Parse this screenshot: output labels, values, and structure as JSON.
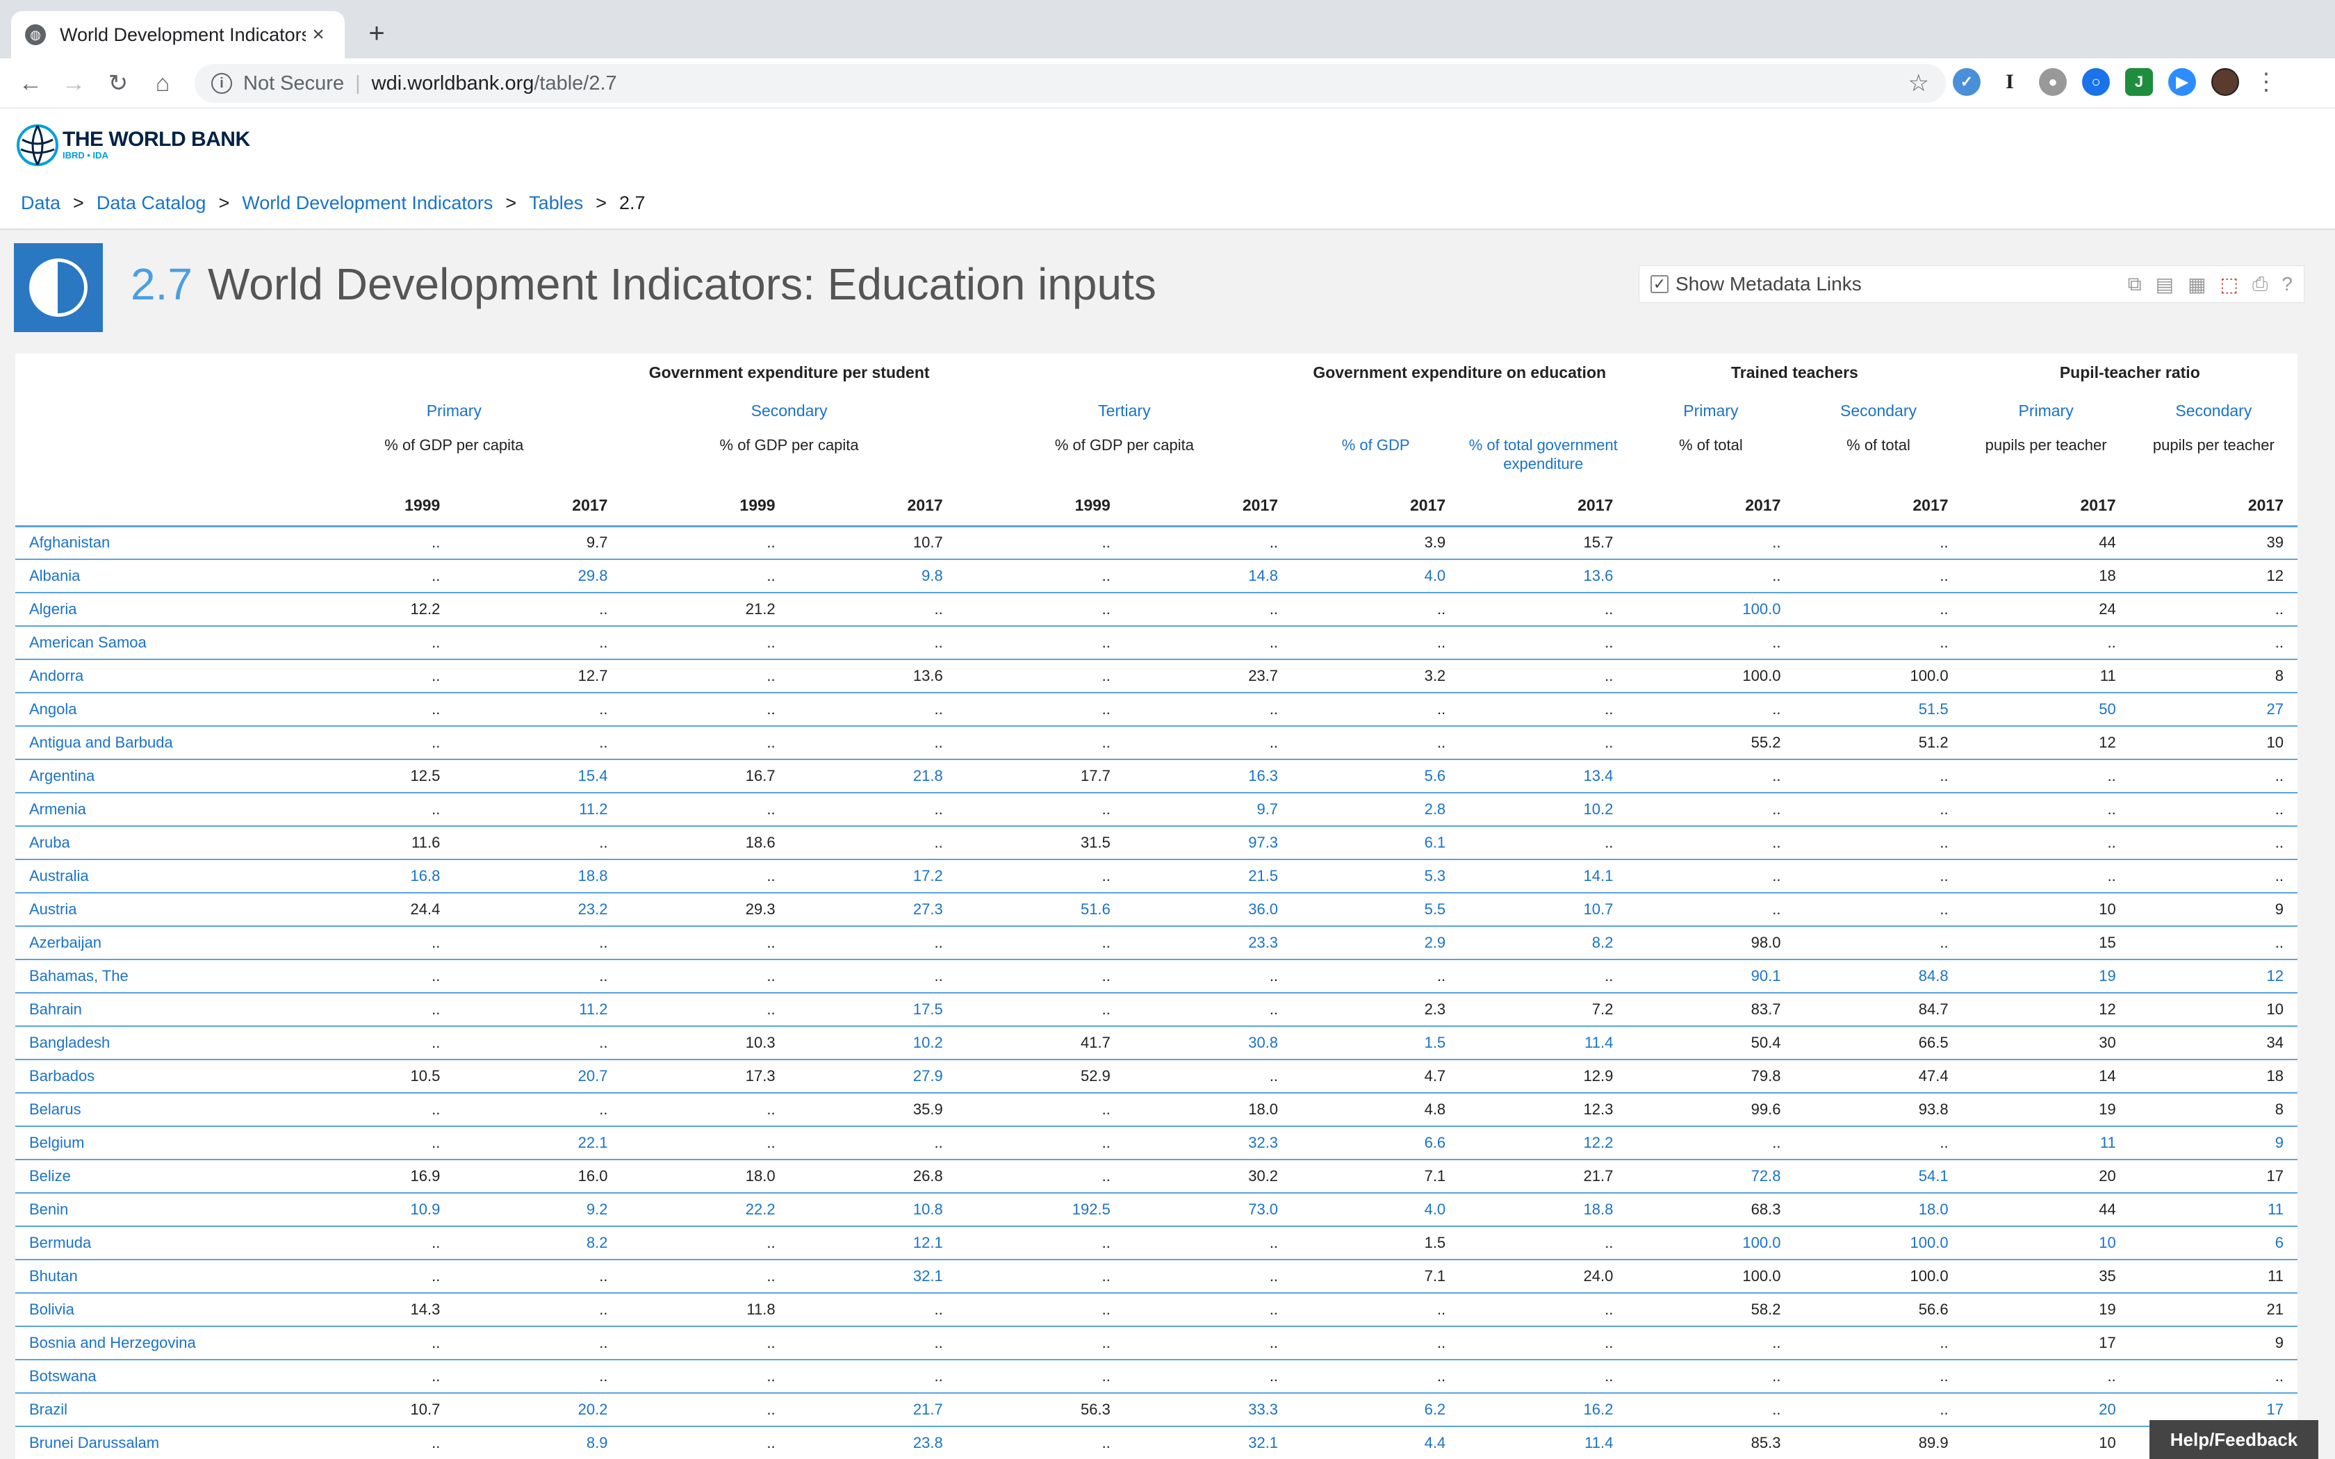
{
  "browser": {
    "tab_title": "World Development Indicators",
    "new_tab": "+",
    "close": "×",
    "security": "Not Secure",
    "url_host": "wdi.worldbank.org",
    "url_path": "/table/2.7"
  },
  "logo": {
    "name": "THE WORLD BANK",
    "sub": "IBRD • IDA"
  },
  "breadcrumb": [
    "Data",
    "Data Catalog",
    "World Development Indicators",
    "Tables",
    "2.7"
  ],
  "header": {
    "number": "2.7",
    "title": "World Development Indicators: Education inputs",
    "metadata_label": "Show Metadata Links",
    "metadata_checked": true
  },
  "help_label": "Help/Feedback",
  "table": {
    "groups": [
      "Government expenditure per student",
      "Government expenditure on education",
      "Trained teachers",
      "Pupil-teacher ratio"
    ],
    "subgroups": [
      "Primary",
      "Secondary",
      "Tertiary",
      "Primary",
      "Secondary",
      "Primary",
      "Secondary"
    ],
    "units": [
      "% of GDP per capita",
      "% of GDP per capita",
      "% of GDP per capita",
      "% of GDP",
      "% of total government expenditure",
      "% of total",
      "% of total",
      "pupils per teacher",
      "pupils per teacher"
    ],
    "years": [
      "1999",
      "2017",
      "1999",
      "2017",
      "1999",
      "2017",
      "2017",
      "2017",
      "2017",
      "2017",
      "2017",
      "2017"
    ],
    "rows": [
      {
        "country": "Afghanistan",
        "v": [
          "..",
          "9.7",
          "..",
          "10.7",
          "..",
          "..",
          "3.9",
          "15.7",
          "..",
          "..",
          "44",
          "39"
        ],
        "b": []
      },
      {
        "country": "Albania",
        "v": [
          "..",
          "29.8",
          "..",
          "9.8",
          "..",
          "14.8",
          "4.0",
          "13.6",
          "..",
          "..",
          "18",
          "12"
        ],
        "b": [
          1,
          3,
          5,
          6,
          7
        ]
      },
      {
        "country": "Algeria",
        "v": [
          "12.2",
          "..",
          "21.2",
          "..",
          "..",
          "..",
          "..",
          "..",
          "100.0",
          "..",
          "24",
          ".."
        ],
        "b": [
          8
        ]
      },
      {
        "country": "American Samoa",
        "v": [
          "..",
          "..",
          "..",
          "..",
          "..",
          "..",
          "..",
          "..",
          "..",
          "..",
          "..",
          ".."
        ],
        "b": []
      },
      {
        "country": "Andorra",
        "v": [
          "..",
          "12.7",
          "..",
          "13.6",
          "..",
          "23.7",
          "3.2",
          "..",
          "100.0",
          "100.0",
          "11",
          "8"
        ],
        "b": []
      },
      {
        "country": "Angola",
        "v": [
          "..",
          "..",
          "..",
          "..",
          "..",
          "..",
          "..",
          "..",
          "..",
          "51.5",
          "50",
          "27"
        ],
        "b": [
          9,
          10,
          11
        ]
      },
      {
        "country": "Antigua and Barbuda",
        "v": [
          "..",
          "..",
          "..",
          "..",
          "..",
          "..",
          "..",
          "..",
          "55.2",
          "51.2",
          "12",
          "10"
        ],
        "b": []
      },
      {
        "country": "Argentina",
        "v": [
          "12.5",
          "15.4",
          "16.7",
          "21.8",
          "17.7",
          "16.3",
          "5.6",
          "13.4",
          "..",
          "..",
          "..",
          ".."
        ],
        "b": [
          1,
          3,
          5,
          6,
          7
        ]
      },
      {
        "country": "Armenia",
        "v": [
          "..",
          "11.2",
          "..",
          "..",
          "..",
          "9.7",
          "2.8",
          "10.2",
          "..",
          "..",
          "..",
          ".."
        ],
        "b": [
          1,
          5,
          6,
          7
        ]
      },
      {
        "country": "Aruba",
        "v": [
          "11.6",
          "..",
          "18.6",
          "..",
          "31.5",
          "97.3",
          "6.1",
          "..",
          "..",
          "..",
          "..",
          ".."
        ],
        "b": [
          5,
          6
        ]
      },
      {
        "country": "Australia",
        "v": [
          "16.8",
          "18.8",
          "..",
          "17.2",
          "..",
          "21.5",
          "5.3",
          "14.1",
          "..",
          "..",
          "..",
          ".."
        ],
        "b": [
          0,
          1,
          3,
          5,
          6,
          7
        ]
      },
      {
        "country": "Austria",
        "v": [
          "24.4",
          "23.2",
          "29.3",
          "27.3",
          "51.6",
          "36.0",
          "5.5",
          "10.7",
          "..",
          "..",
          "10",
          "9"
        ],
        "b": [
          1,
          3,
          4,
          5,
          6,
          7
        ]
      },
      {
        "country": "Azerbaijan",
        "v": [
          "..",
          "..",
          "..",
          "..",
          "..",
          "23.3",
          "2.9",
          "8.2",
          "98.0",
          "..",
          "15",
          ".."
        ],
        "b": [
          5,
          6,
          7
        ]
      },
      {
        "country": "Bahamas, The",
        "v": [
          "..",
          "..",
          "..",
          "..",
          "..",
          "..",
          "..",
          "..",
          "90.1",
          "84.8",
          "19",
          "12"
        ],
        "b": [
          8,
          9,
          10,
          11
        ]
      },
      {
        "country": "Bahrain",
        "v": [
          "..",
          "11.2",
          "..",
          "17.5",
          "..",
          "..",
          "2.3",
          "7.2",
          "83.7",
          "84.7",
          "12",
          "10"
        ],
        "b": [
          1,
          3
        ]
      },
      {
        "country": "Bangladesh",
        "v": [
          "..",
          "..",
          "10.3",
          "10.2",
          "41.7",
          "30.8",
          "1.5",
          "11.4",
          "50.4",
          "66.5",
          "30",
          "34"
        ],
        "b": [
          3,
          5,
          6,
          7
        ]
      },
      {
        "country": "Barbados",
        "v": [
          "10.5",
          "20.7",
          "17.3",
          "27.9",
          "52.9",
          "..",
          "4.7",
          "12.9",
          "79.8",
          "47.4",
          "14",
          "18"
        ],
        "b": [
          1,
          3
        ]
      },
      {
        "country": "Belarus",
        "v": [
          "..",
          "..",
          "..",
          "35.9",
          "..",
          "18.0",
          "4.8",
          "12.3",
          "99.6",
          "93.8",
          "19",
          "8"
        ],
        "b": []
      },
      {
        "country": "Belgium",
        "v": [
          "..",
          "22.1",
          "..",
          "..",
          "..",
          "32.3",
          "6.6",
          "12.2",
          "..",
          "..",
          "11",
          "9"
        ],
        "b": [
          1,
          5,
          6,
          7,
          10,
          11
        ]
      },
      {
        "country": "Belize",
        "v": [
          "16.9",
          "16.0",
          "18.0",
          "26.8",
          "..",
          "30.2",
          "7.1",
          "21.7",
          "72.8",
          "54.1",
          "20",
          "17"
        ],
        "b": [
          8,
          9
        ]
      },
      {
        "country": "Benin",
        "v": [
          "10.9",
          "9.2",
          "22.2",
          "10.8",
          "192.5",
          "73.0",
          "4.0",
          "18.8",
          "68.3",
          "18.0",
          "44",
          "11"
        ],
        "b": [
          0,
          1,
          2,
          3,
          4,
          5,
          6,
          7,
          9,
          11
        ]
      },
      {
        "country": "Bermuda",
        "v": [
          "..",
          "8.2",
          "..",
          "12.1",
          "..",
          "..",
          "1.5",
          "..",
          "100.0",
          "100.0",
          "10",
          "6"
        ],
        "b": [
          1,
          3,
          8,
          9,
          10,
          11
        ]
      },
      {
        "country": "Bhutan",
        "v": [
          "..",
          "..",
          "..",
          "32.1",
          "..",
          "..",
          "7.1",
          "24.0",
          "100.0",
          "100.0",
          "35",
          "11"
        ],
        "b": [
          3
        ]
      },
      {
        "country": "Bolivia",
        "v": [
          "14.3",
          "..",
          "11.8",
          "..",
          "..",
          "..",
          "..",
          "..",
          "58.2",
          "56.6",
          "19",
          "21"
        ],
        "b": []
      },
      {
        "country": "Bosnia and Herzegovina",
        "v": [
          "..",
          "..",
          "..",
          "..",
          "..",
          "..",
          "..",
          "..",
          "..",
          "..",
          "17",
          "9"
        ],
        "b": []
      },
      {
        "country": "Botswana",
        "v": [
          "..",
          "..",
          "..",
          "..",
          "..",
          "..",
          "..",
          "..",
          "..",
          "..",
          "..",
          ".."
        ],
        "b": []
      },
      {
        "country": "Brazil",
        "v": [
          "10.7",
          "20.2",
          "..",
          "21.7",
          "56.3",
          "33.3",
          "6.2",
          "16.2",
          "..",
          "..",
          "20",
          "17"
        ],
        "b": [
          1,
          3,
          5,
          6,
          7,
          10,
          11
        ]
      },
      {
        "country": "Brunei Darussalam",
        "v": [
          "..",
          "8.9",
          "..",
          "23.8",
          "..",
          "32.1",
          "4.4",
          "11.4",
          "85.3",
          "89.9",
          "10",
          ".."
        ],
        "b": [
          1,
          3,
          5,
          6,
          7
        ]
      }
    ]
  }
}
